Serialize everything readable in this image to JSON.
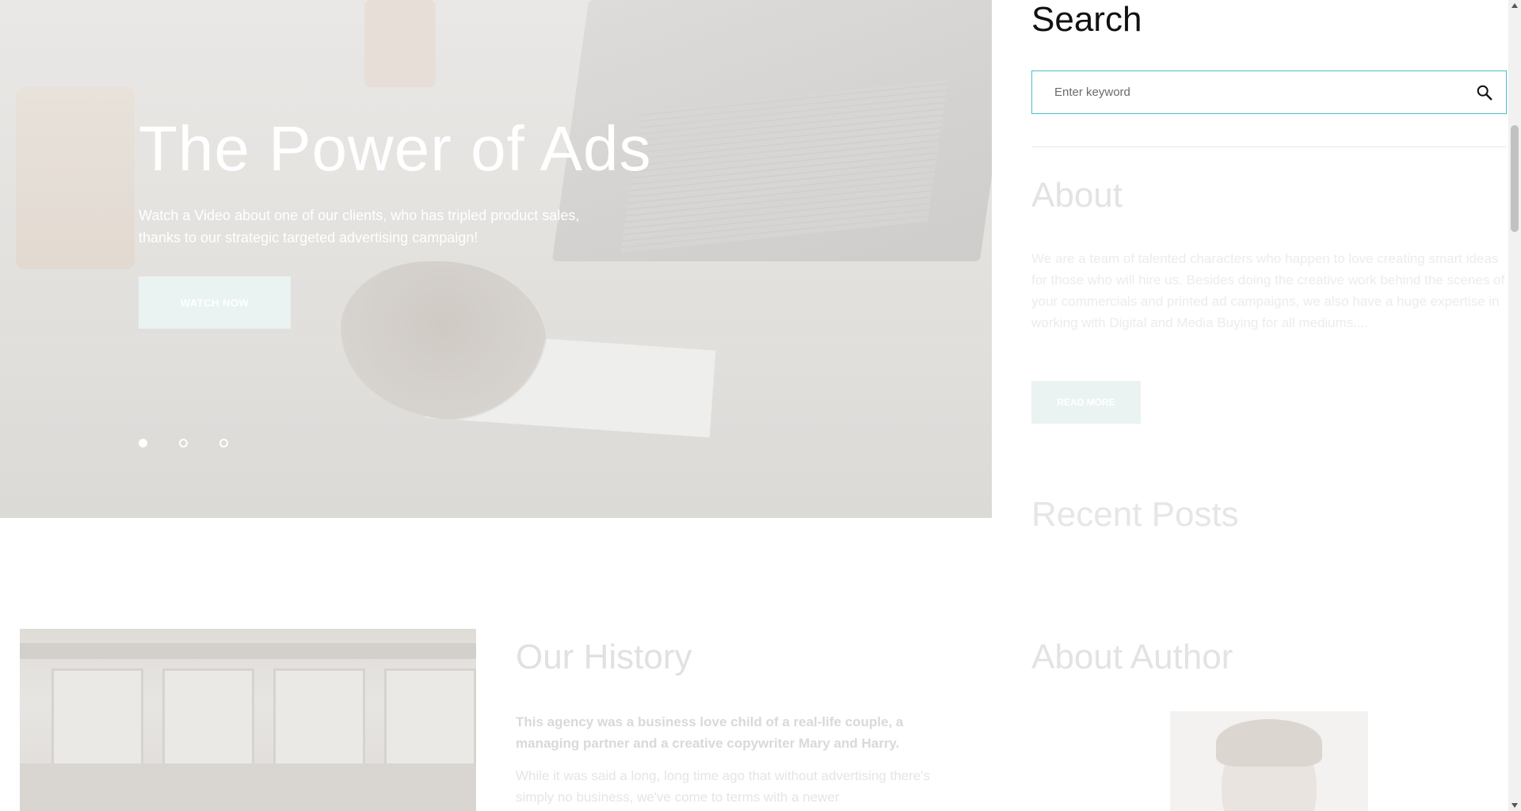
{
  "hero": {
    "title": "The Power of Ads",
    "subtitle": "Watch a Video about one of our clients, who has tripled product sales, thanks to our strategic targeted advertising campaign!",
    "button_label": "WATCH NOW",
    "slides": [
      {
        "active": true
      },
      {
        "active": false
      },
      {
        "active": false
      }
    ]
  },
  "sidebar": {
    "search": {
      "title": "Search",
      "placeholder": "Enter keyword",
      "icon": "search-icon"
    },
    "about": {
      "title": "About",
      "text": "We are a team of talented characters who happen to love creating smart ideas for those who will hire us. Besides doing the creative work behind the scenes of your commercials and printed ad campaigns, we also have a huge expertise in working with Digital and Media Buying for all mediums....",
      "button_label": "READ MORE"
    },
    "recent_posts": {
      "title": "Recent Posts"
    },
    "about_author": {
      "title": "About Author"
    }
  },
  "history": {
    "title": "Our History",
    "lead": "This agency was a business love child of a real-life couple, a managing partner and a creative copywriter Mary and Harry.",
    "text": "While it was said a long, long time ago that without advertising there's simply no business, we've come to terms with a newer"
  },
  "colors": {
    "accent": "#47c1c8",
    "button_bg": "#eaf3f2",
    "heading": "#111111"
  }
}
